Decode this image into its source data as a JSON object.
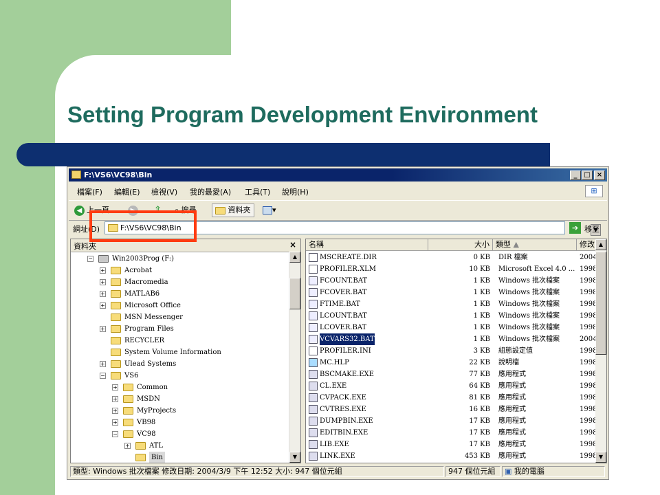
{
  "slide": {
    "title": "Setting Program Development Environment",
    "colors": {
      "green": "#a3cf9a",
      "navy": "#0d2f70",
      "title": "#1e6b5e",
      "highlight": "#ff3b10"
    }
  },
  "window": {
    "title": "F:\\VS6\\VC98\\Bin",
    "menu": [
      "檔案(F)",
      "編輯(E)",
      "檢視(V)",
      "我的最愛(A)",
      "工具(T)",
      "說明(H)"
    ],
    "toolbar": {
      "back": "上一頁",
      "search": "搜尋",
      "folders": "資料夾"
    },
    "address": {
      "label": "網址(D)",
      "value": "F:\\VS6\\VC98\\Bin",
      "go": "移至"
    },
    "tree": {
      "header": "資料夾",
      "items": [
        {
          "label": "Win2003Prog (F:)",
          "depth": 0,
          "exp": "−",
          "icon": "drive-icon"
        },
        {
          "label": "Acrobat",
          "depth": 1,
          "exp": "+"
        },
        {
          "label": "Macromedia",
          "depth": 1,
          "exp": "+"
        },
        {
          "label": "MATLAB6",
          "depth": 1,
          "exp": "+"
        },
        {
          "label": "Microsoft Office",
          "depth": 1,
          "exp": "+"
        },
        {
          "label": "MSN Messenger",
          "depth": 1,
          "exp": ""
        },
        {
          "label": "Program Files",
          "depth": 1,
          "exp": "+"
        },
        {
          "label": "RECYCLER",
          "depth": 1,
          "exp": ""
        },
        {
          "label": "System Volume Information",
          "depth": 1,
          "exp": ""
        },
        {
          "label": "Ulead Systems",
          "depth": 1,
          "exp": "+"
        },
        {
          "label": "VS6",
          "depth": 1,
          "exp": "−"
        },
        {
          "label": "Common",
          "depth": 2,
          "exp": "+"
        },
        {
          "label": "MSDN",
          "depth": 2,
          "exp": "+"
        },
        {
          "label": "MyProjects",
          "depth": 2,
          "exp": "+"
        },
        {
          "label": "VB98",
          "depth": 2,
          "exp": "+"
        },
        {
          "label": "VC98",
          "depth": 2,
          "exp": "−"
        },
        {
          "label": "ATL",
          "depth": 3,
          "exp": "+"
        },
        {
          "label": "Bin",
          "depth": 3,
          "exp": "",
          "selected": true
        }
      ]
    },
    "columns": [
      "名稱",
      "大小",
      "類型",
      "修改"
    ],
    "files": [
      {
        "name": "MSCREATE.DIR",
        "size": "0 KB",
        "type": "DIR 檔案",
        "date": "2004"
      },
      {
        "name": "PROFILER.XLM",
        "size": "10 KB",
        "type": "Microsoft Excel 4.0 ...",
        "date": "1998"
      },
      {
        "name": "FCOUNT.BAT",
        "size": "1 KB",
        "type": "Windows 批次檔案",
        "date": "1998"
      },
      {
        "name": "FCOVER.BAT",
        "size": "1 KB",
        "type": "Windows 批次檔案",
        "date": "1998"
      },
      {
        "name": "FTIME.BAT",
        "size": "1 KB",
        "type": "Windows 批次檔案",
        "date": "1998"
      },
      {
        "name": "LCOUNT.BAT",
        "size": "1 KB",
        "type": "Windows 批次檔案",
        "date": "1998"
      },
      {
        "name": "LCOVER.BAT",
        "size": "1 KB",
        "type": "Windows 批次檔案",
        "date": "1998"
      },
      {
        "name": "VCVARS32.BAT",
        "size": "1 KB",
        "type": "Windows 批次檔案",
        "date": "2004",
        "selected": true
      },
      {
        "name": "PROFILER.INI",
        "size": "3 KB",
        "type": "組態設定值",
        "date": "1998"
      },
      {
        "name": "MC.HLP",
        "size": "22 KB",
        "type": "說明檔",
        "date": "1998"
      },
      {
        "name": "BSCMAKE.EXE",
        "size": "77 KB",
        "type": "應用程式",
        "date": "1998"
      },
      {
        "name": "CL.EXE",
        "size": "64 KB",
        "type": "應用程式",
        "date": "1998"
      },
      {
        "name": "CVPACK.EXE",
        "size": "81 KB",
        "type": "應用程式",
        "date": "1998"
      },
      {
        "name": "CVTRES.EXE",
        "size": "16 KB",
        "type": "應用程式",
        "date": "1998"
      },
      {
        "name": "DUMPBIN.EXE",
        "size": "17 KB",
        "type": "應用程式",
        "date": "1998"
      },
      {
        "name": "EDITBIN.EXE",
        "size": "17 KB",
        "type": "應用程式",
        "date": "1998"
      },
      {
        "name": "LIB.EXE",
        "size": "17 KB",
        "type": "應用程式",
        "date": "1998"
      },
      {
        "name": "LINK.EXE",
        "size": "453 KB",
        "type": "應用程式",
        "date": "1998"
      }
    ],
    "status": {
      "info": "類型: Windows 批次檔案 修改日期: 2004/3/9 下午 12:52 大小: 947 個位元組",
      "size": "947 個位元組",
      "zone": "我的電腦"
    }
  }
}
